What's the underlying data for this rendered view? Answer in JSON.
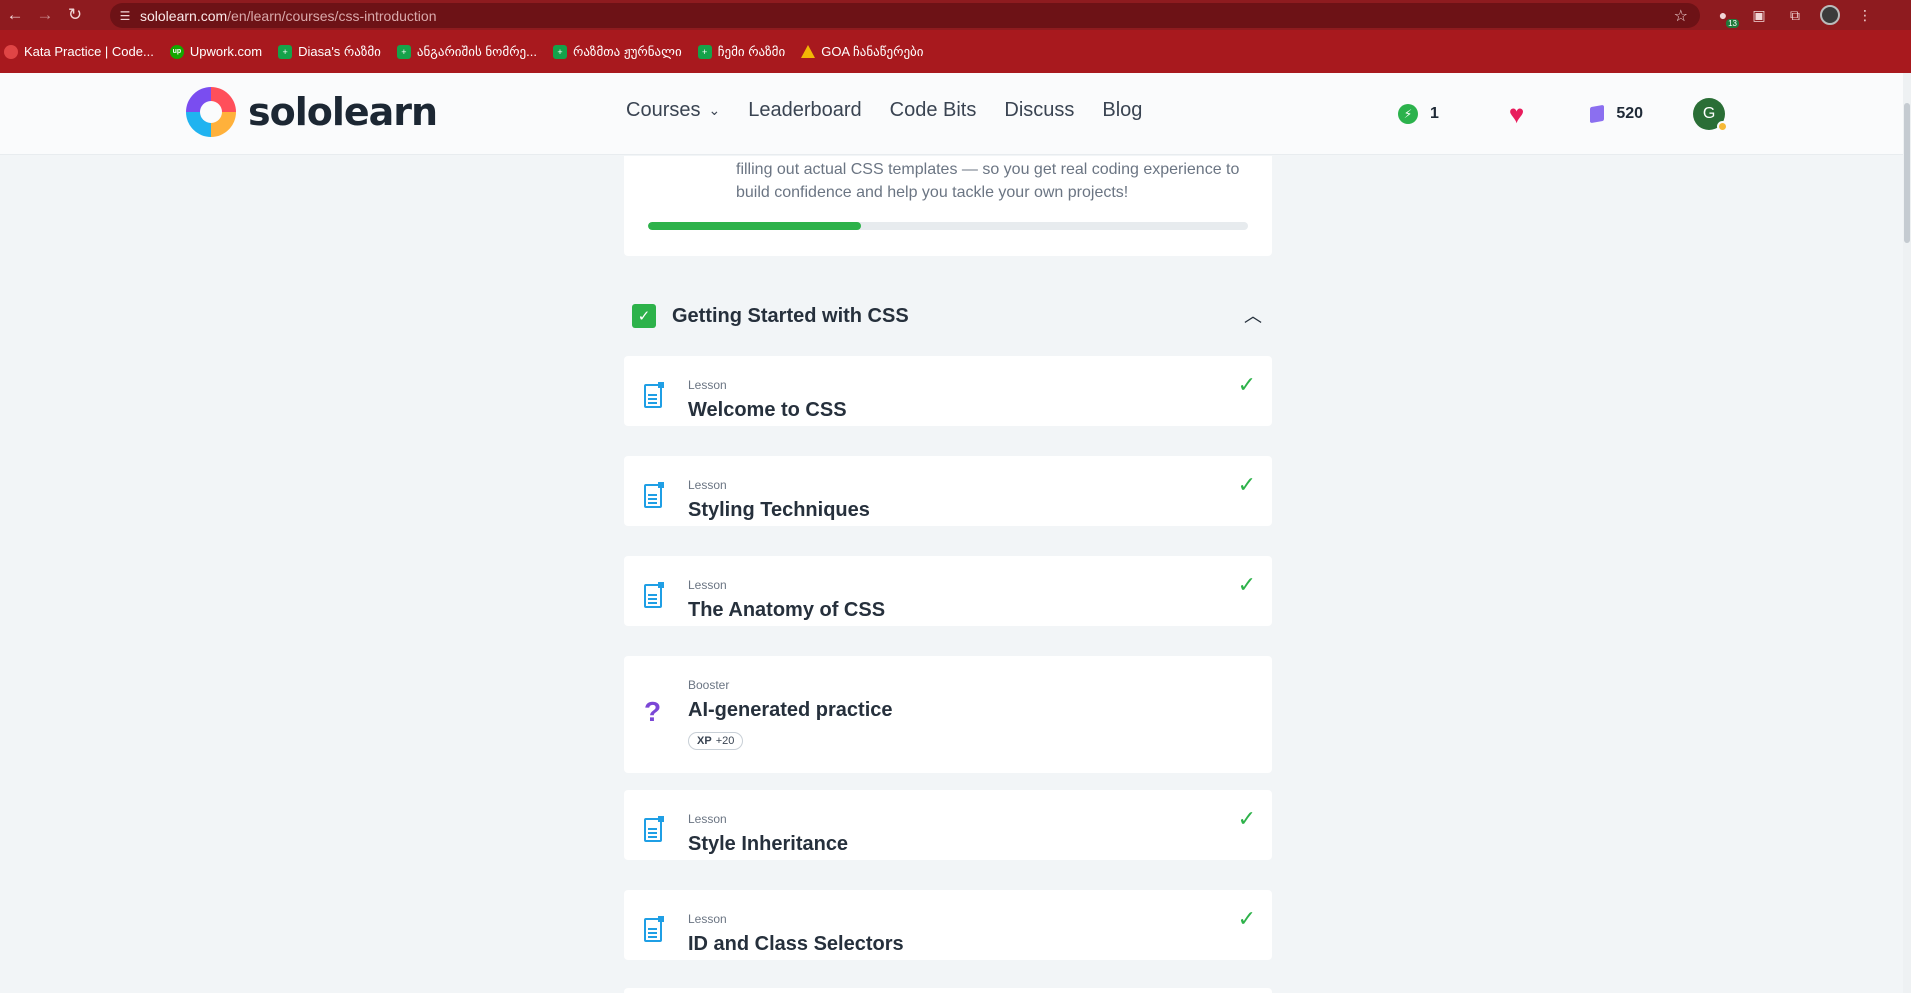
{
  "browser": {
    "url_host": "sololearn.com",
    "url_path": "/en/learn/courses/css-introduction",
    "extension_badge": "13",
    "bookmarks": [
      {
        "label": "Kata Practice | Code...",
        "icon": "red"
      },
      {
        "label": "Upwork.com",
        "icon": "upwork",
        "glyph": "up"
      },
      {
        "label": "Diasa's რაზმი",
        "icon": "green",
        "glyph": "+"
      },
      {
        "label": "ანგარიშის ნომრე...",
        "icon": "green",
        "glyph": "+"
      },
      {
        "label": "რაზმთა ჟურნალი",
        "icon": "green",
        "glyph": "+"
      },
      {
        "label": "ჩემი რაზმი",
        "icon": "green",
        "glyph": "+"
      },
      {
        "label": "GOA ჩანაწერები",
        "icon": "drive"
      }
    ]
  },
  "header": {
    "logo_text": "sololearn",
    "nav": {
      "courses": "Courses",
      "leaderboard": "Leaderboard",
      "code_bits": "Code Bits",
      "discuss": "Discuss",
      "blog": "Blog"
    },
    "energy_count": "1",
    "gems_count": "520",
    "avatar_letter": "G"
  },
  "course": {
    "description": "filling out actual CSS templates — so you get real coding experience to build confidence and help you tackle your own projects!",
    "progress_percent": 35.5
  },
  "section": {
    "title": "Getting Started with CSS",
    "completed": true
  },
  "lessons": [
    {
      "kind": "Lesson",
      "name": "Welcome to CSS",
      "done": true
    },
    {
      "kind": "Lesson",
      "name": "Styling Techniques",
      "done": true
    },
    {
      "kind": "Lesson",
      "name": "The Anatomy of CSS",
      "done": true
    },
    {
      "kind": "Booster",
      "name": "AI-generated practice",
      "done": false,
      "xp_label": "XP",
      "xp_value": "+20"
    },
    {
      "kind": "Lesson",
      "name": "Style Inheritance",
      "done": true
    },
    {
      "kind": "Lesson",
      "name": "ID and Class Selectors",
      "done": true
    }
  ],
  "colors": {
    "accent_green": "#2db24a",
    "lesson_blue": "#1f9fe5",
    "booster_purple": "#7b47d6",
    "browser_red": "#a8191e"
  }
}
